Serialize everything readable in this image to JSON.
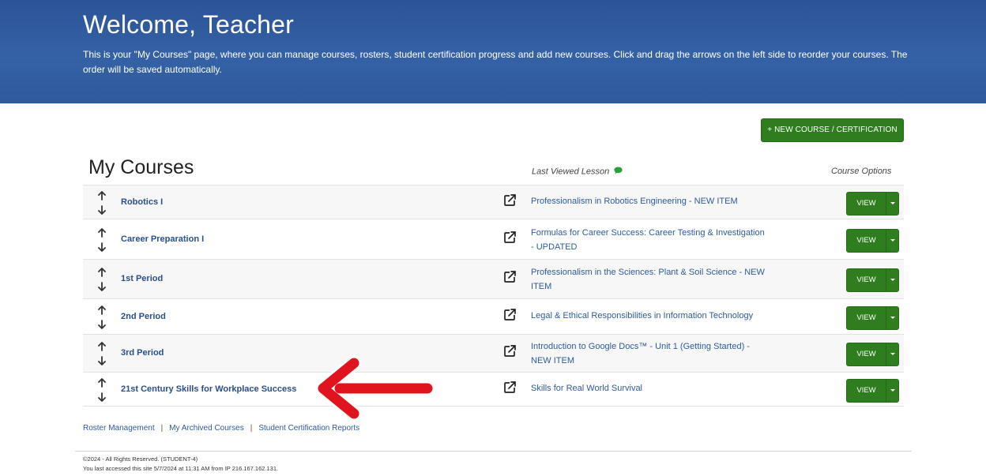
{
  "hero": {
    "title": "Welcome, Teacher",
    "description": "This is your \"My Courses\" page, where you can manage courses, rosters, student certification progress and add new courses. Click and drag the arrows on the left side to reorder your courses. The order will be saved automatically."
  },
  "new_course_button": "+ NEW COURSE / CERTIFICATION",
  "section_title": "My Courses",
  "columns": {
    "last_viewed": "Last Viewed Lesson",
    "course_options": "Course Options"
  },
  "courses": [
    {
      "name": "Robotics I",
      "lesson": "Professionalism in Robotics Engineering - NEW ITEM",
      "action": "VIEW"
    },
    {
      "name": "Career Preparation I",
      "lesson": "Formulas for Career Success: Career Testing & Investigation - UPDATED",
      "action": "VIEW"
    },
    {
      "name": "1st Period",
      "lesson": "Professionalism in the Sciences: Plant & Soil Science - NEW ITEM",
      "action": "VIEW"
    },
    {
      "name": "2nd Period",
      "lesson": "Legal & Ethical Responsibilities in Information Technology",
      "action": "VIEW"
    },
    {
      "name": "3rd Period",
      "lesson": "Introduction to Google Docs™ - Unit 1 (Getting Started) - NEW ITEM",
      "action": "VIEW"
    },
    {
      "name": "21st Century Skills for Workplace Success",
      "lesson": "Skills for Real World Survival",
      "action": "VIEW"
    }
  ],
  "footer_links": [
    "Roster Management",
    "My Archived Courses",
    "Student Certification Reports"
  ],
  "footer_link_separator": "|",
  "footer": {
    "copyright": "©2024 - All Rights Reserved. (STUDENT-4)",
    "last_access": "You last accessed this site 5/7/2024 at 11:31 AM from IP 216.167.162.131."
  },
  "colors": {
    "hero_blue": "#3561a6",
    "button_green": "#2e7d1f",
    "link_blue": "#2f5a9c",
    "annotation_red": "#e0141e"
  },
  "icons": {
    "reorder": "up-down-arrows-icon",
    "external_link": "external-link-icon",
    "comment": "comment-bubble-icon",
    "caret": "caret-down-icon"
  }
}
